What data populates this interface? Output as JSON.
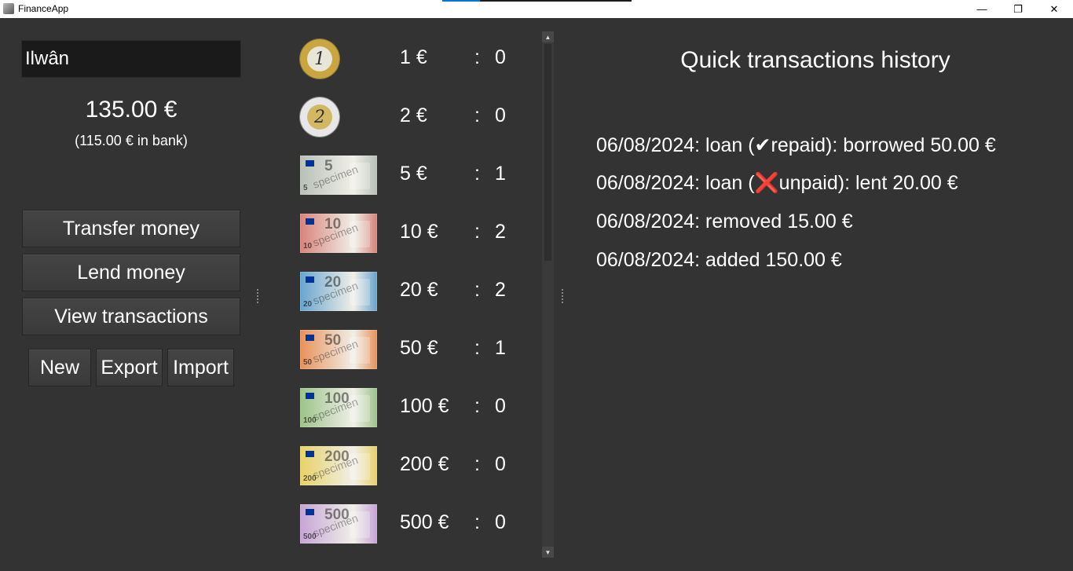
{
  "window": {
    "title": "FinanceApp",
    "minimize_glyph": "—",
    "restore_glyph": "❐",
    "close_glyph": "✕"
  },
  "account": {
    "name": "Ilwân",
    "balance": "135.00 €",
    "bank": "(115.00 € in bank)"
  },
  "actions": {
    "transfer": "Transfer money",
    "lend": "Lend money",
    "view": "View transactions",
    "new": "New",
    "export": "Export",
    "import": "Import"
  },
  "money": {
    "colon": ":",
    "items": [
      {
        "label": "1 €",
        "count": "0",
        "kind": "coin",
        "icon": "1-euro-coin-icon",
        "face": "1"
      },
      {
        "label": "2 €",
        "count": "0",
        "kind": "coin",
        "icon": "2-euro-coin-icon",
        "face": "2"
      },
      {
        "label": "5 €",
        "count": "1",
        "kind": "note",
        "icon": "5-euro-note-icon",
        "face": "5",
        "color": "#b9c1b8"
      },
      {
        "label": "10 €",
        "count": "2",
        "kind": "note",
        "icon": "10-euro-note-icon",
        "face": "10",
        "color": "#d8867c"
      },
      {
        "label": "20 €",
        "count": "2",
        "kind": "note",
        "icon": "20-euro-note-icon",
        "face": "20",
        "color": "#6aa6cf"
      },
      {
        "label": "50 €",
        "count": "1",
        "kind": "note",
        "icon": "50-euro-note-icon",
        "face": "50",
        "color": "#e8935c"
      },
      {
        "label": "100 €",
        "count": "0",
        "kind": "note",
        "icon": "100-euro-note-icon",
        "face": "100",
        "color": "#9ec48a"
      },
      {
        "label": "200 €",
        "count": "0",
        "kind": "note",
        "icon": "200-euro-note-icon",
        "face": "200",
        "color": "#e8d26a"
      },
      {
        "label": "500 €",
        "count": "0",
        "kind": "note",
        "icon": "500-euro-note-icon",
        "face": "500",
        "color": "#c7a6d6"
      }
    ]
  },
  "history": {
    "title": "Quick transactions history",
    "items": [
      "06/08/2024: loan (✔repaid): borrowed 50.00 €",
      "06/08/2024: loan (❌unpaid): lent 20.00 €",
      "06/08/2024: removed 15.00 €",
      "06/08/2024: added 150.00 €"
    ]
  }
}
